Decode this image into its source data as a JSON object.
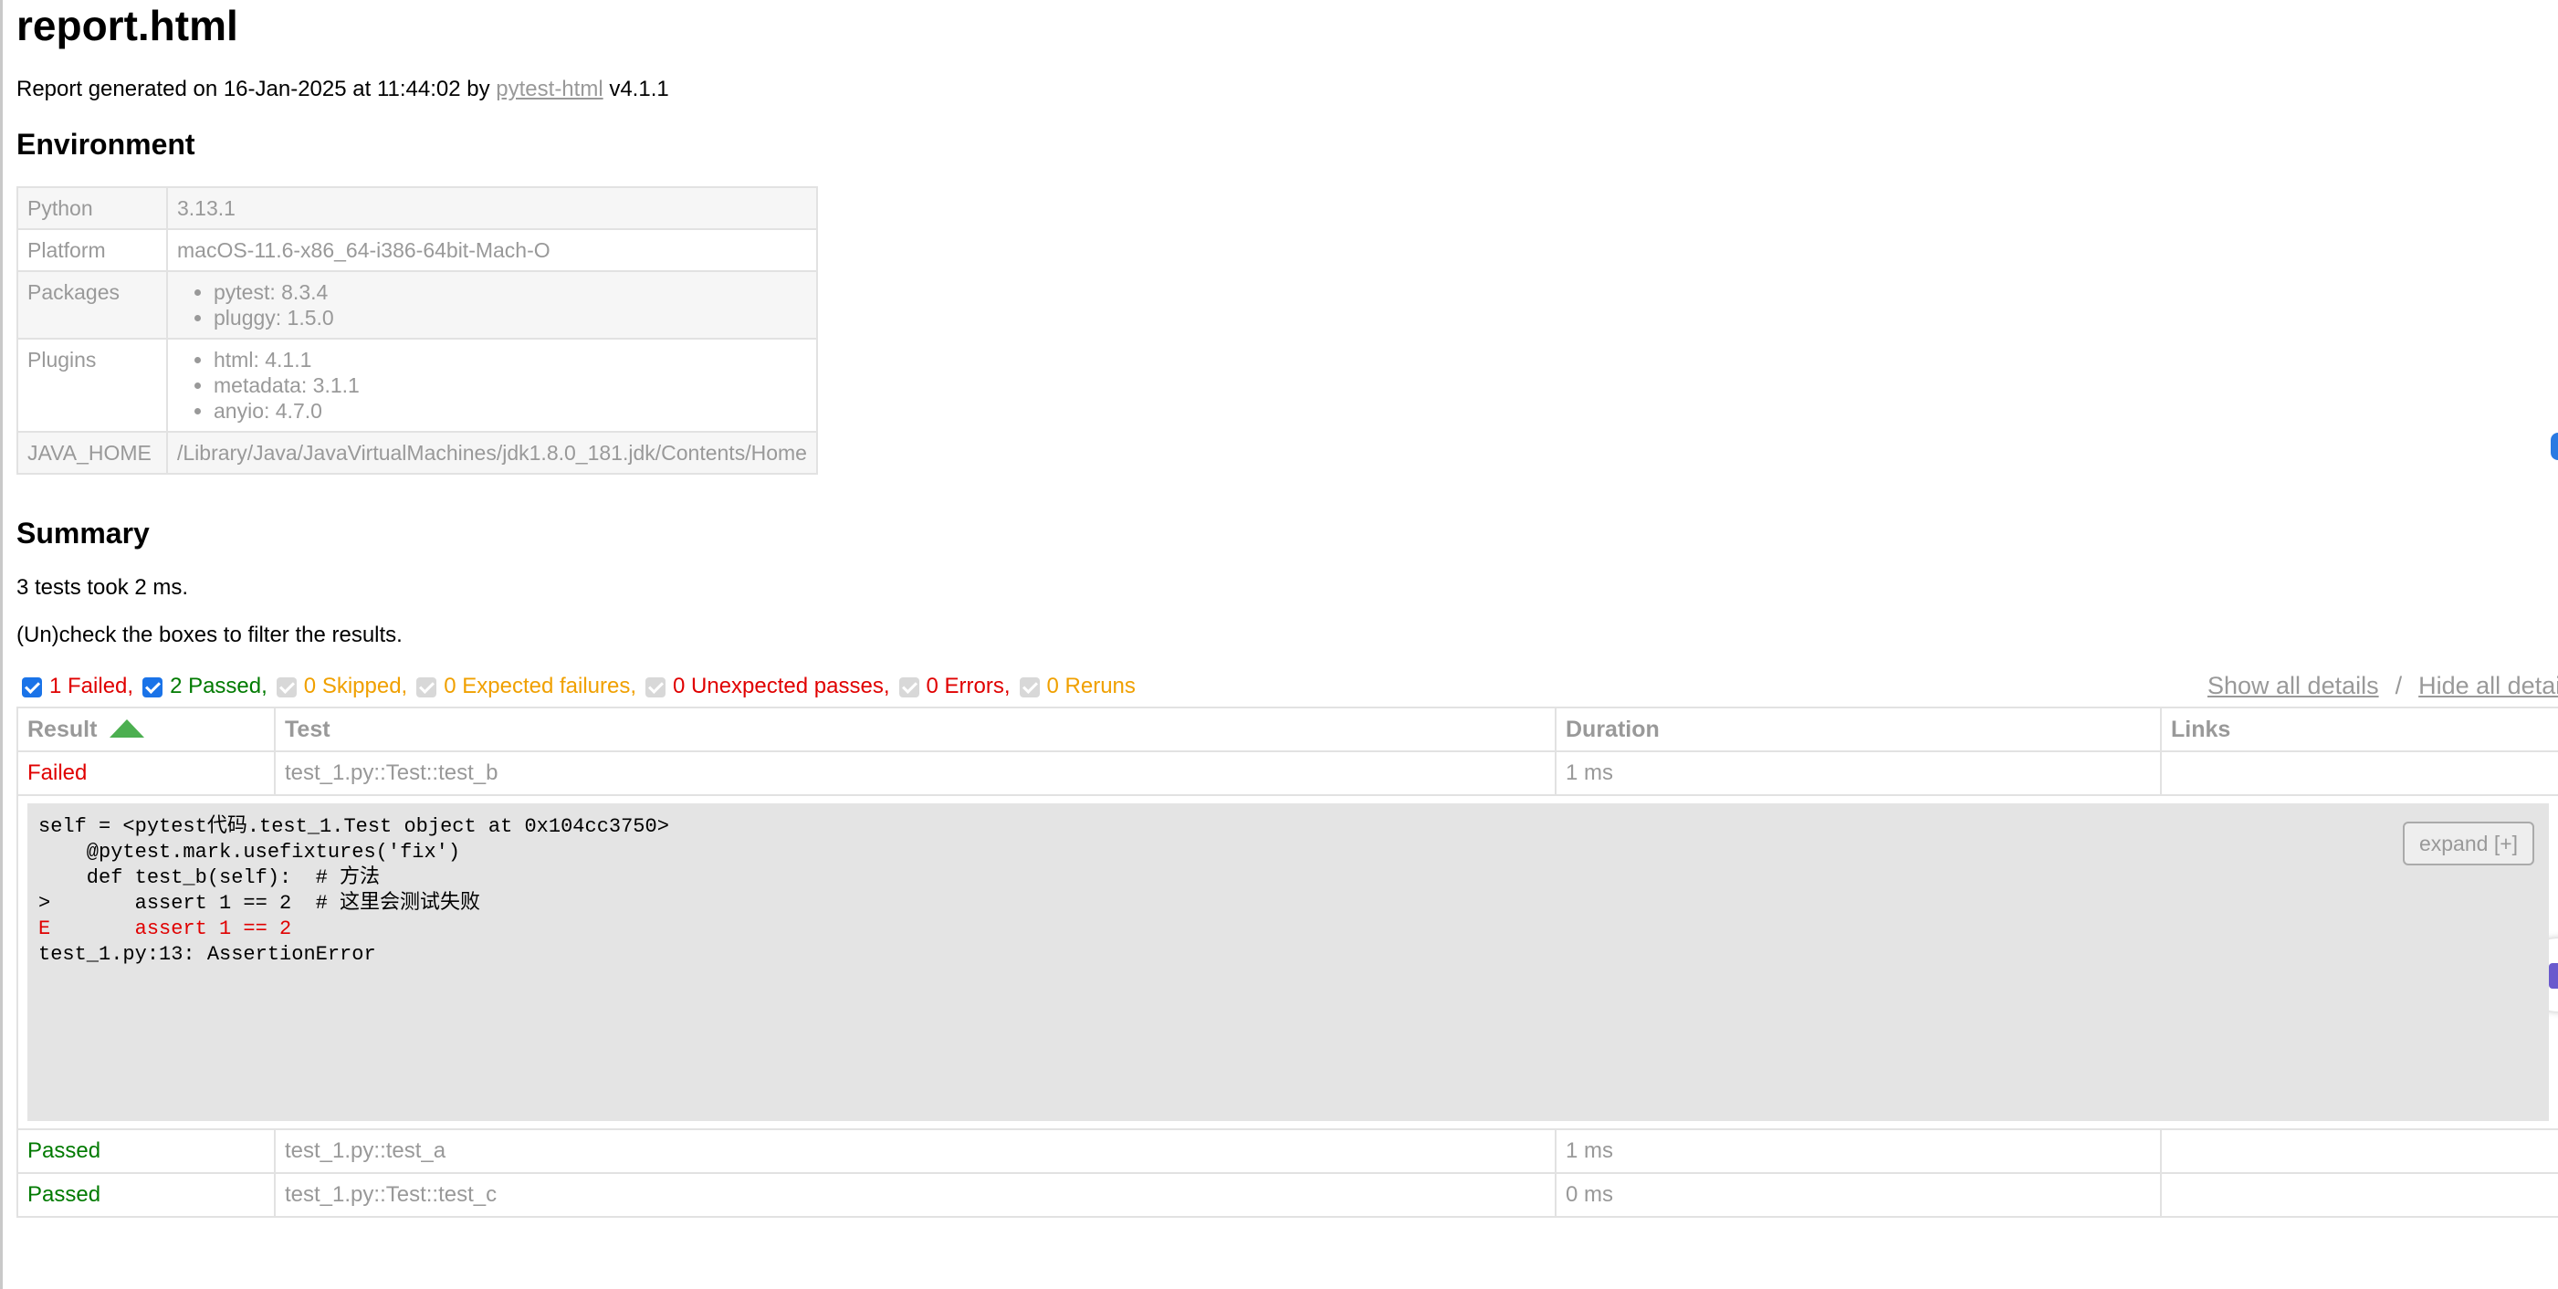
{
  "title": "report.html",
  "generated": {
    "prefix": "Report generated on 16-Jan-2025 at 11:44:02 by ",
    "link": "pytest-html",
    "suffix": " v4.1.1"
  },
  "environment": {
    "heading": "Environment",
    "rows": {
      "python": {
        "key": "Python",
        "value": "3.13.1"
      },
      "platform": {
        "key": "Platform",
        "value": "macOS-11.6-x86_64-i386-64bit-Mach-O"
      },
      "packages": {
        "key": "Packages",
        "items": [
          "pytest: 8.3.4",
          "pluggy: 1.5.0"
        ]
      },
      "plugins": {
        "key": "Plugins",
        "items": [
          "html: 4.1.1",
          "metadata: 3.1.1",
          "anyio: 4.7.0"
        ]
      },
      "java_home": {
        "key": "JAVA_HOME",
        "value": "/Library/Java/JavaVirtualMachines/jdk1.8.0_181.jdk/Contents/Home"
      }
    }
  },
  "summary": {
    "heading": "Summary",
    "duration_text": "3 tests took 2 ms.",
    "filter_hint": "(Un)check the boxes to filter the results.",
    "filters": {
      "failed": "1 Failed,",
      "passed": "2 Passed,",
      "skipped": "0 Skipped,",
      "xfailed": "0 Expected failures,",
      "xpassed": "0 Unexpected passes,",
      "errors": "0 Errors,",
      "reruns": "0 Reruns"
    },
    "show_all": "Show all details",
    "separator": "/",
    "hide_all": "Hide all details"
  },
  "results": {
    "headers": {
      "result": "Result",
      "test": "Test",
      "duration": "Duration",
      "links": "Links"
    },
    "rows": [
      {
        "result": "Failed",
        "test": "test_1.py::Test::test_b",
        "duration": "1 ms",
        "links": ""
      },
      {
        "result": "Passed",
        "test": "test_1.py::test_a",
        "duration": "1 ms",
        "links": ""
      },
      {
        "result": "Passed",
        "test": "test_1.py::Test::test_c",
        "duration": "0 ms",
        "links": ""
      }
    ],
    "log": {
      "lines": [
        "self = <pytest代码.test_1.Test object at 0x104cc3750>",
        "",
        "    @pytest.mark.usefixtures('fix')",
        "    def test_b(self):  # 方法",
        ">       assert 1 == 2  # 这里会测试失败",
        "E       assert 1 == 2",
        "",
        "test_1.py:13: AssertionError"
      ],
      "expand_label": "expand [+]"
    }
  },
  "colors": {
    "failed": "#e00000",
    "passed": "#007a00",
    "neutral": "#f0a000",
    "checkbox": "#1a73e8",
    "sort_arrow": "#4caf50"
  }
}
